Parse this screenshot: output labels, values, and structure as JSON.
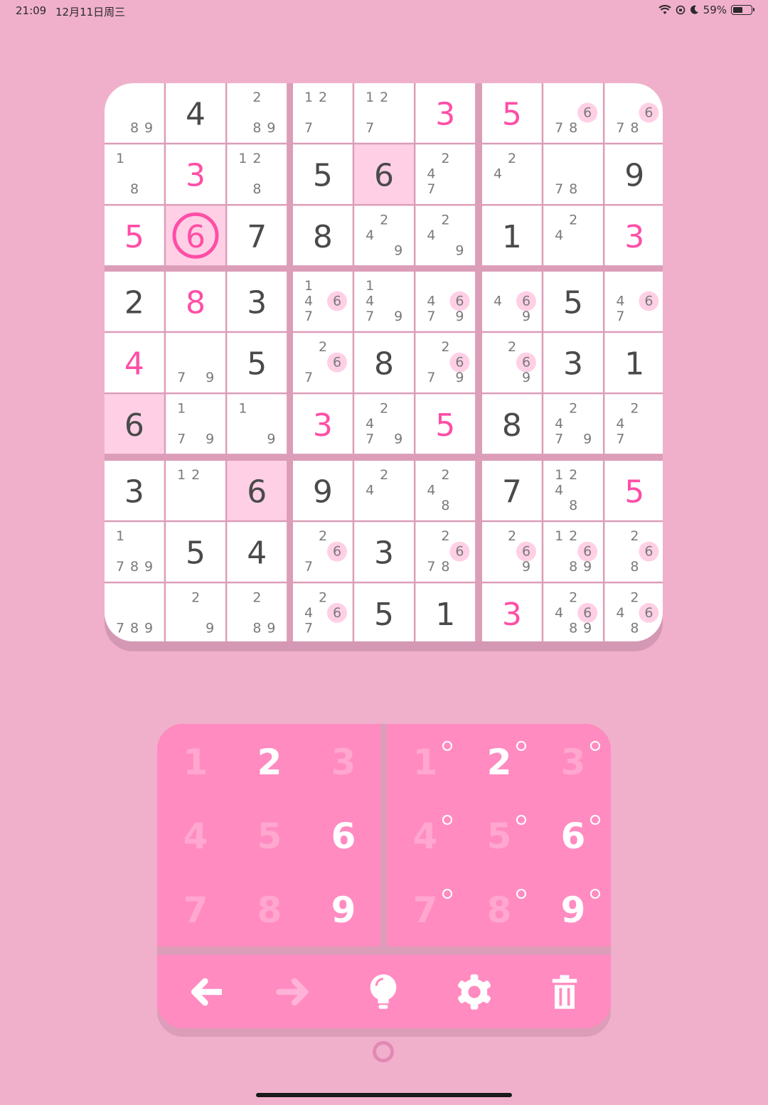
{
  "status_bar": {
    "time": "21:09",
    "date": "12月11日周三",
    "battery": "59%",
    "battery_fraction": 0.59
  },
  "colors": {
    "background": "#f0b0cb",
    "cell": "#ffffff",
    "highlight": "#ffd0e5",
    "given": "#4a4a4a",
    "entered": "#ff4ea6",
    "note": "#7a7a7a",
    "note_mark": "#ffd0e5",
    "pad": "#ff8bc1"
  },
  "board": {
    "cells": [
      [
        {
          "v": "",
          "notes": [
            8,
            9
          ]
        },
        {
          "v": "4",
          "t": "g"
        },
        {
          "v": "",
          "notes": [
            2,
            8,
            9
          ]
        },
        {
          "v": "",
          "notes": [
            1,
            2,
            7
          ]
        },
        {
          "v": "",
          "notes": [
            1,
            2,
            7
          ]
        },
        {
          "v": "3",
          "t": "e"
        },
        {
          "v": "5",
          "t": "e"
        },
        {
          "v": "",
          "notes": [
            6,
            7,
            8
          ],
          "mark": 6
        },
        {
          "v": "",
          "notes": [
            6,
            7,
            8
          ],
          "mark": 6
        }
      ],
      [
        {
          "v": "",
          "notes": [
            1,
            8
          ]
        },
        {
          "v": "3",
          "t": "e"
        },
        {
          "v": "",
          "notes": [
            1,
            2,
            8
          ]
        },
        {
          "v": "5",
          "t": "g"
        },
        {
          "v": "6",
          "t": "g",
          "hl": true
        },
        {
          "v": "",
          "notes": [
            2,
            4,
            7
          ]
        },
        {
          "v": "",
          "notes": [
            2,
            4
          ]
        },
        {
          "v": "",
          "notes": [
            7,
            8
          ]
        },
        {
          "v": "9",
          "t": "g"
        }
      ],
      [
        {
          "v": "5",
          "t": "e"
        },
        {
          "v": "6",
          "t": "e",
          "hl": true,
          "circle": true
        },
        {
          "v": "7",
          "t": "g"
        },
        {
          "v": "8",
          "t": "g"
        },
        {
          "v": "",
          "notes": [
            2,
            4,
            9
          ]
        },
        {
          "v": "",
          "notes": [
            2,
            4,
            9
          ]
        },
        {
          "v": "1",
          "t": "g"
        },
        {
          "v": "",
          "notes": [
            2,
            4
          ]
        },
        {
          "v": "3",
          "t": "e"
        }
      ],
      [
        {
          "v": "2",
          "t": "g"
        },
        {
          "v": "8",
          "t": "e"
        },
        {
          "v": "3",
          "t": "g"
        },
        {
          "v": "",
          "notes": [
            1,
            4,
            6,
            7
          ],
          "mark": 6
        },
        {
          "v": "",
          "notes": [
            1,
            4,
            7,
            9
          ]
        },
        {
          "v": "",
          "notes": [
            4,
            6,
            7,
            9
          ],
          "mark": 6
        },
        {
          "v": "",
          "notes": [
            4,
            6,
            9
          ],
          "mark": 6
        },
        {
          "v": "5",
          "t": "g"
        },
        {
          "v": "",
          "notes": [
            4,
            6,
            7
          ],
          "mark": 6
        }
      ],
      [
        {
          "v": "4",
          "t": "e"
        },
        {
          "v": "",
          "notes": [
            7,
            9
          ]
        },
        {
          "v": "5",
          "t": "g"
        },
        {
          "v": "",
          "notes": [
            2,
            6,
            7
          ],
          "mark": 6
        },
        {
          "v": "8",
          "t": "g"
        },
        {
          "v": "",
          "notes": [
            2,
            6,
            7,
            9
          ],
          "mark": 6
        },
        {
          "v": "",
          "notes": [
            2,
            6,
            9
          ],
          "mark": 6
        },
        {
          "v": "3",
          "t": "g"
        },
        {
          "v": "1",
          "t": "g"
        }
      ],
      [
        {
          "v": "6",
          "t": "g",
          "hl": true
        },
        {
          "v": "",
          "notes": [
            1,
            7,
            9
          ]
        },
        {
          "v": "",
          "notes": [
            1,
            9
          ]
        },
        {
          "v": "3",
          "t": "e"
        },
        {
          "v": "",
          "notes": [
            2,
            4,
            7,
            9
          ]
        },
        {
          "v": "5",
          "t": "e"
        },
        {
          "v": "8",
          "t": "g"
        },
        {
          "v": "",
          "notes": [
            2,
            4,
            7,
            9
          ]
        },
        {
          "v": "",
          "notes": [
            2,
            4,
            7
          ]
        }
      ],
      [
        {
          "v": "3",
          "t": "g"
        },
        {
          "v": "",
          "notes": [
            1,
            2
          ]
        },
        {
          "v": "6",
          "t": "g",
          "hl": true
        },
        {
          "v": "9",
          "t": "g"
        },
        {
          "v": "",
          "notes": [
            2,
            4
          ]
        },
        {
          "v": "",
          "notes": [
            2,
            4,
            8
          ]
        },
        {
          "v": "7",
          "t": "g"
        },
        {
          "v": "",
          "notes": [
            1,
            2,
            4,
            8
          ]
        },
        {
          "v": "5",
          "t": "e"
        }
      ],
      [
        {
          "v": "",
          "notes": [
            1,
            7,
            8,
            9
          ]
        },
        {
          "v": "5",
          "t": "g"
        },
        {
          "v": "4",
          "t": "g"
        },
        {
          "v": "",
          "notes": [
            2,
            6,
            7
          ],
          "mark": 6
        },
        {
          "v": "3",
          "t": "g"
        },
        {
          "v": "",
          "notes": [
            2,
            6,
            7,
            8
          ],
          "mark": 6
        },
        {
          "v": "",
          "notes": [
            2,
            6,
            9
          ],
          "mark": 6
        },
        {
          "v": "",
          "notes": [
            1,
            2,
            6,
            8,
            9
          ],
          "mark": 6
        },
        {
          "v": "",
          "notes": [
            2,
            6,
            8
          ],
          "mark": 6
        }
      ],
      [
        {
          "v": "",
          "notes": [
            7,
            8,
            9
          ]
        },
        {
          "v": "",
          "notes": [
            2,
            9
          ]
        },
        {
          "v": "",
          "notes": [
            2,
            8,
            9
          ]
        },
        {
          "v": "",
          "notes": [
            2,
            4,
            6,
            7
          ],
          "mark": 6
        },
        {
          "v": "5",
          "t": "g"
        },
        {
          "v": "1",
          "t": "g"
        },
        {
          "v": "3",
          "t": "e"
        },
        {
          "v": "",
          "notes": [
            2,
            4,
            6,
            8,
            9
          ],
          "mark": 6
        },
        {
          "v": "",
          "notes": [
            2,
            4,
            6,
            8
          ],
          "mark": 6
        }
      ]
    ]
  },
  "pad": {
    "digits": [
      {
        "label": "1",
        "enabled": false
      },
      {
        "label": "2",
        "enabled": true
      },
      {
        "label": "3",
        "enabled": false
      },
      {
        "label": "4",
        "enabled": false
      },
      {
        "label": "5",
        "enabled": false
      },
      {
        "label": "6",
        "enabled": true
      },
      {
        "label": "7",
        "enabled": false
      },
      {
        "label": "8",
        "enabled": false
      },
      {
        "label": "9",
        "enabled": true
      }
    ],
    "tools": [
      {
        "name": "undo-button",
        "icon": "arrow-left-icon",
        "enabled": true
      },
      {
        "name": "redo-button",
        "icon": "arrow-right-icon",
        "enabled": false
      },
      {
        "name": "hint-button",
        "icon": "lightbulb-icon",
        "enabled": true
      },
      {
        "name": "settings-button",
        "icon": "gear-icon",
        "enabled": true
      },
      {
        "name": "delete-button",
        "icon": "trash-icon",
        "enabled": true
      }
    ]
  }
}
